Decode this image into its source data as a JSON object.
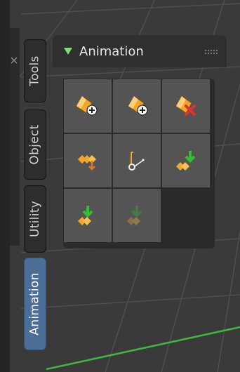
{
  "tabs": [
    {
      "label": "Tools",
      "active": false
    },
    {
      "label": "Object",
      "active": false
    },
    {
      "label": "Utility",
      "active": false
    },
    {
      "label": "Animation",
      "active": true
    }
  ],
  "panel": {
    "title": "Animation",
    "expanded": true
  },
  "tools": [
    {
      "icon": "insert-keyframe-icon",
      "enabled": true
    },
    {
      "icon": "insert-keyframe-add-icon",
      "enabled": true
    },
    {
      "icon": "delete-keyframe-icon",
      "enabled": true
    },
    {
      "icon": "keyframes-timeline-icon",
      "enabled": true
    },
    {
      "icon": "bake-action-icon",
      "enabled": true
    },
    {
      "icon": "keyframe-insert-down-icon",
      "enabled": true
    },
    {
      "icon": "keyframe-import-icon",
      "enabled": true
    },
    {
      "icon": "keyframe-import-disabled-icon",
      "enabled": false
    }
  ],
  "colors": {
    "accent": "#4b6e98",
    "panel_arrow": "#7fe07a",
    "axis_line": "#3fb43f"
  }
}
